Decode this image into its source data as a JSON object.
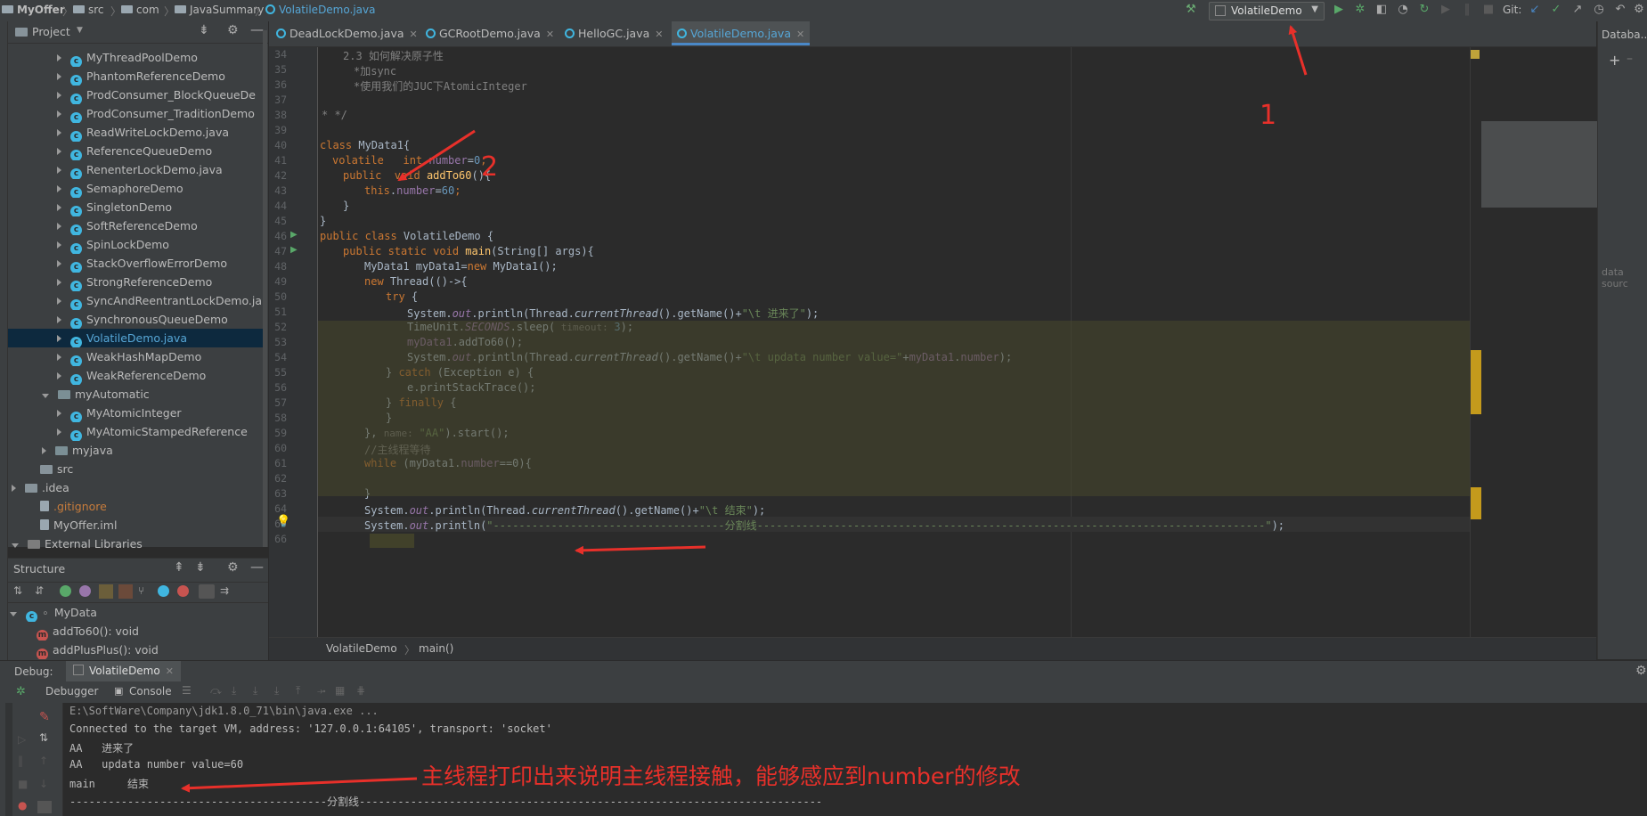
{
  "breadcrumb": [
    "MyOffer",
    "src",
    "com",
    "JavaSummary",
    "VolatileDemo.java"
  ],
  "run_config": "VolatileDemo",
  "vcs_label": "Git:",
  "project_panel": {
    "title": "Project",
    "items": [
      {
        "label": "MyThreadPoolDemo",
        "kind": "class",
        "indent": 3
      },
      {
        "label": "PhantomReferenceDemo",
        "kind": "class",
        "indent": 3
      },
      {
        "label": "ProdConsumer_BlockQueueDe",
        "kind": "class",
        "indent": 3
      },
      {
        "label": "ProdConsumer_TraditionDemo",
        "kind": "class",
        "indent": 3
      },
      {
        "label": "ReadWriteLockDemo.java",
        "kind": "class",
        "indent": 3
      },
      {
        "label": "ReferenceQueueDemo",
        "kind": "class",
        "indent": 3
      },
      {
        "label": "RenenterLockDemo.java",
        "kind": "class",
        "indent": 3
      },
      {
        "label": "SemaphoreDemo",
        "kind": "class",
        "indent": 3
      },
      {
        "label": "SingletonDemo",
        "kind": "class",
        "indent": 3
      },
      {
        "label": "SoftReferenceDemo",
        "kind": "class",
        "indent": 3
      },
      {
        "label": "SpinLockDemo",
        "kind": "class",
        "indent": 3
      },
      {
        "label": "StackOverflowErrorDemo",
        "kind": "class",
        "indent": 3
      },
      {
        "label": "StrongReferenceDemo",
        "kind": "class",
        "indent": 3
      },
      {
        "label": "SyncAndReentrantLockDemo.ja",
        "kind": "class",
        "indent": 3
      },
      {
        "label": "SynchronousQueueDemo",
        "kind": "class",
        "indent": 3
      },
      {
        "label": "VolatileDemo.java",
        "kind": "class",
        "indent": 3,
        "selected": true
      },
      {
        "label": "WeakHashMapDemo",
        "kind": "class",
        "indent": 3
      },
      {
        "label": "WeakReferenceDemo",
        "kind": "class",
        "indent": 3
      },
      {
        "label": "myAutomatic",
        "kind": "package",
        "indent": 2,
        "open": true
      },
      {
        "label": "MyAtomicInteger",
        "kind": "class",
        "indent": 3
      },
      {
        "label": "MyAtomicStampedReference",
        "kind": "class",
        "indent": 3
      },
      {
        "label": "myjava",
        "kind": "package",
        "indent": 2
      },
      {
        "label": "src",
        "kind": "folder",
        "indent": 1,
        "noarrow": true
      },
      {
        "label": ".idea",
        "kind": "folder",
        "indent": 0
      },
      {
        "label": ".gitignore",
        "kind": "file-ignore",
        "indent": 1,
        "noarrow": true
      },
      {
        "label": "MyOffer.iml",
        "kind": "file",
        "indent": 1,
        "noarrow": true
      },
      {
        "label": "External Libraries",
        "kind": "lib",
        "indent": 0,
        "open": true
      }
    ]
  },
  "structure_panel": {
    "title": "Structure",
    "items": [
      {
        "label": "MyData",
        "kind": "class"
      },
      {
        "label": "addTo60(): void",
        "kind": "method"
      },
      {
        "label": "addPlusPlus(): void",
        "kind": "method"
      }
    ]
  },
  "tabs": [
    {
      "label": "DeadLockDemo.java"
    },
    {
      "label": "GCRootDemo.java"
    },
    {
      "label": "HelloGC.java"
    },
    {
      "label": "VolatileDemo.java",
      "active": true
    }
  ],
  "line_numbers": [
    "34",
    "35",
    "36",
    "37",
    "38",
    "39",
    "40",
    "41",
    "42",
    "43",
    "44",
    "45",
    "46",
    "47",
    "48",
    "49",
    "50",
    "51",
    "52",
    "53",
    "54",
    "55",
    "56",
    "57",
    "58",
    "59",
    "60",
    "61",
    "62",
    "63",
    "64",
    "65",
    "66"
  ],
  "code": {
    "l34": "2.3 如何解决原子性",
    "l35": "*加sync",
    "l36": "*使用我们的JUC下AtomicInteger",
    "l38": "* */",
    "l40_kw": "class",
    "l40_name": " MyData1{",
    "l41_kw": "volatile",
    "l41_type": "   int ",
    "l41_field": "number",
    "l41_eq": "=",
    "l41_num": "0",
    "l41_end": ";",
    "l42_kw": "public",
    "l42_void": "  void ",
    "l42_fn": "addTo60",
    "l42_end": "(){",
    "l43_kw": "this",
    "l43_dot": ".",
    "l43_field": "number",
    "l43_eq": "=",
    "l43_num": "60",
    "l43_end": ";",
    "l44": "}",
    "l45": "}",
    "l46_kw": "public class",
    "l46_rest": " VolatileDemo {",
    "l47_kw": "public static void",
    "l47_fn": " main",
    "l47_rest": "(String[] args){",
    "l48_a": "MyData1 myData1=",
    "l48_kw": "new",
    "l48_b": " MyData1();",
    "l49_kw": "new",
    "l49_rest": " Thread(()->{",
    "l50_kw": "try",
    "l50_rest": " {",
    "l51_a": "System.",
    "l51_out": "out",
    "l51_b": ".println(Thread.",
    "l51_ct": "currentThread",
    "l51_c": "().getName()+",
    "l51_str": "\"\\t 进来了\"",
    "l51_end": ");",
    "l52_a": "TimeUnit.",
    "l52_sec": "SECONDS",
    "l52_b": ".sleep(",
    "l52_hint": " timeout: ",
    "l52_num": "3",
    "l52_end": ");",
    "l53_var": "myData1",
    "l53_rest": ".addTo60();",
    "l54_a": "System.",
    "l54_out": "out",
    "l54_b": ".println(Thread.",
    "l54_ct": "currentThread",
    "l54_c": "().getName()+",
    "l54_str": "\"\\t updata number value=\"",
    "l54_plus": "+",
    "l54_var": "myData1",
    "l54_d": ".",
    "l54_field": "number",
    "l54_end": ");",
    "l55_a": "} ",
    "l55_kw": "catch",
    "l55_rest": " (Exception e) {",
    "l56": "e.printStackTrace();",
    "l57_a": "} ",
    "l57_kw": "finally",
    "l57_rest": " {",
    "l58": "}",
    "l59_a": "}, ",
    "l59_hint": "name: ",
    "l59_str": "\"AA\"",
    "l59_rest": ").start();",
    "l60": "//主线程等待",
    "l61_kw": "while",
    "l61_a": " (myData1.",
    "l61_field": "number",
    "l61_rest": "==0){",
    "l63": "}",
    "l64_a": "System.",
    "l64_out": "out",
    "l64_b": ".println(Thread.",
    "l64_ct": "currentThread",
    "l64_c": "().getName()+",
    "l64_str": "\"\\t 结束\"",
    "l64_end": ");",
    "l65_a": "System.",
    "l65_out": "out",
    "l65_b": ".println(",
    "l65_str": "\"------------------------------------分割线-------------------------------------------------------------------------------\"",
    "l65_end": ");"
  },
  "editor_breadcrumb": [
    "VolatileDemo",
    "main()"
  ],
  "right_panel_title": "Databa...",
  "right_panel_hint": "data sourc",
  "debug": {
    "label": "Debug:",
    "session": "VolatileDemo",
    "tabs": [
      "Debugger",
      "Console"
    ]
  },
  "console_lines": [
    "E:\\SoftWare\\Company\\jdk1.8.0_71\\bin\\java.exe ...",
    "Connected to the target VM, address: '127.0.0.1:64105', transport: 'socket'",
    "AA   进来了",
    "AA   updata number value=60",
    "main     结束",
    "----------------------------------------分割线------------------------------------------------------------------------"
  ],
  "annotations": {
    "n1": "1",
    "n2": "2",
    "note": "主线程打印出来说明主线程接触，能够感应到number的修改"
  },
  "colors": {
    "accent": "#4a88c7",
    "annotation": "#e8302a",
    "selection": "#0d293e"
  }
}
